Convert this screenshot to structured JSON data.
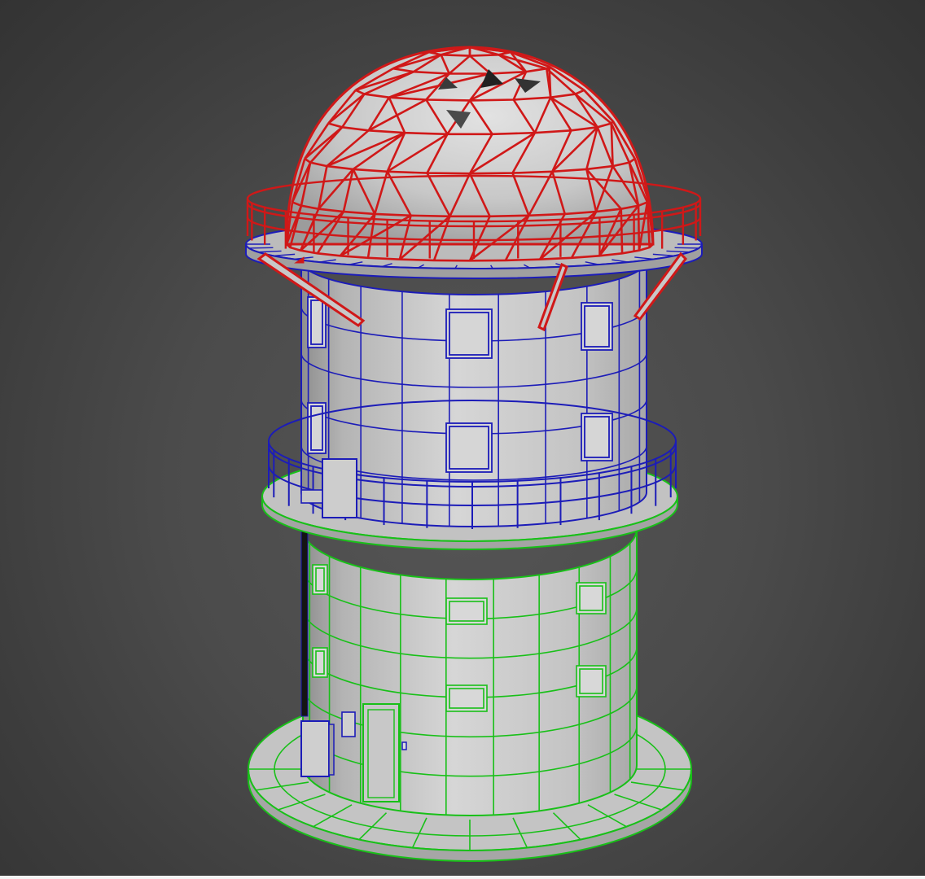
{
  "scene": {
    "background_top": "#2f2f2f",
    "background_bottom": "#4e4e4e",
    "surface_color": "#c9c9c9",
    "surface_shadow": "#9a9a9a",
    "parts": [
      {
        "name": "dome",
        "wire_color": "#d01818"
      },
      {
        "name": "upper-tank",
        "wire_color": "#1c1cb8"
      },
      {
        "name": "lower-tower",
        "wire_color": "#18c018"
      }
    ]
  }
}
